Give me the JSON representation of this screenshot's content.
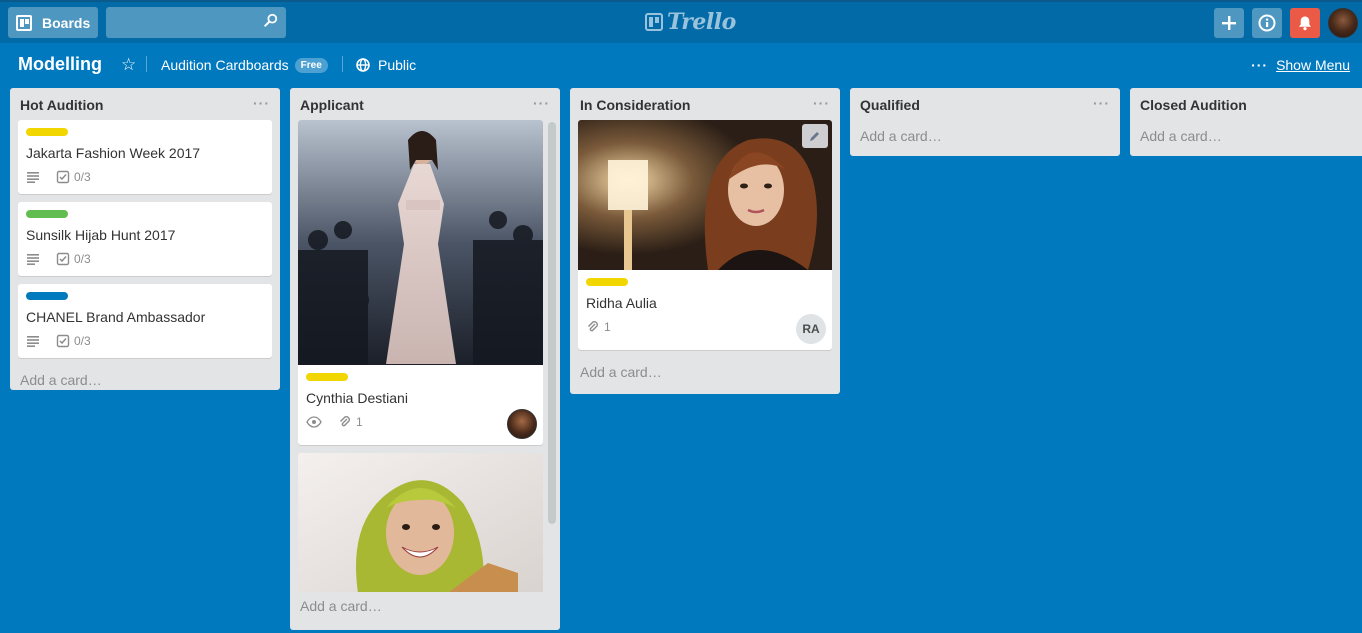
{
  "header": {
    "boards_label": "Boards",
    "search_value": "",
    "logo_text": "Trello",
    "add_label": "+",
    "info_label": "i"
  },
  "board": {
    "title": "Modelling",
    "team": "Audition Cardboards",
    "team_badge": "Free",
    "visibility": "Public",
    "show_menu": "Show Menu",
    "menu_dots": "···"
  },
  "colors": {
    "board_bg": "#0079bf",
    "label_yellow": "#f2d600",
    "label_green": "#61bd4f",
    "label_blue": "#0079bf",
    "notification": "#eb5a46"
  },
  "lists": [
    {
      "title": "Hot Audition",
      "add_card": "Add a card…",
      "cards": [
        {
          "label": "yellow",
          "title": "Jakarta Fashion Week 2017",
          "checklist": "0/3"
        },
        {
          "label": "green",
          "title": "Sunsilk Hijab Hunt 2017",
          "checklist": "0/3"
        },
        {
          "label": "blue",
          "title": "CHANEL Brand Ambassador",
          "checklist": "0/3"
        }
      ]
    },
    {
      "title": "Applicant",
      "add_card": "Add a card…",
      "cards": [
        {
          "label": "yellow",
          "title": "Cynthia Destiani",
          "attachments": "1",
          "cover": "runway-photo"
        },
        {
          "cover": "hijab-photo"
        }
      ]
    },
    {
      "title": "In Consideration",
      "add_card": "Add a card…",
      "cards": [
        {
          "label": "yellow",
          "title": "Ridha Aulia",
          "attachments": "1",
          "member": "RA",
          "cover": "portrait-photo"
        }
      ]
    },
    {
      "title": "Qualified",
      "add_card": "Add a card…"
    },
    {
      "title": "Closed Audition",
      "add_card": "Add a card…"
    }
  ]
}
